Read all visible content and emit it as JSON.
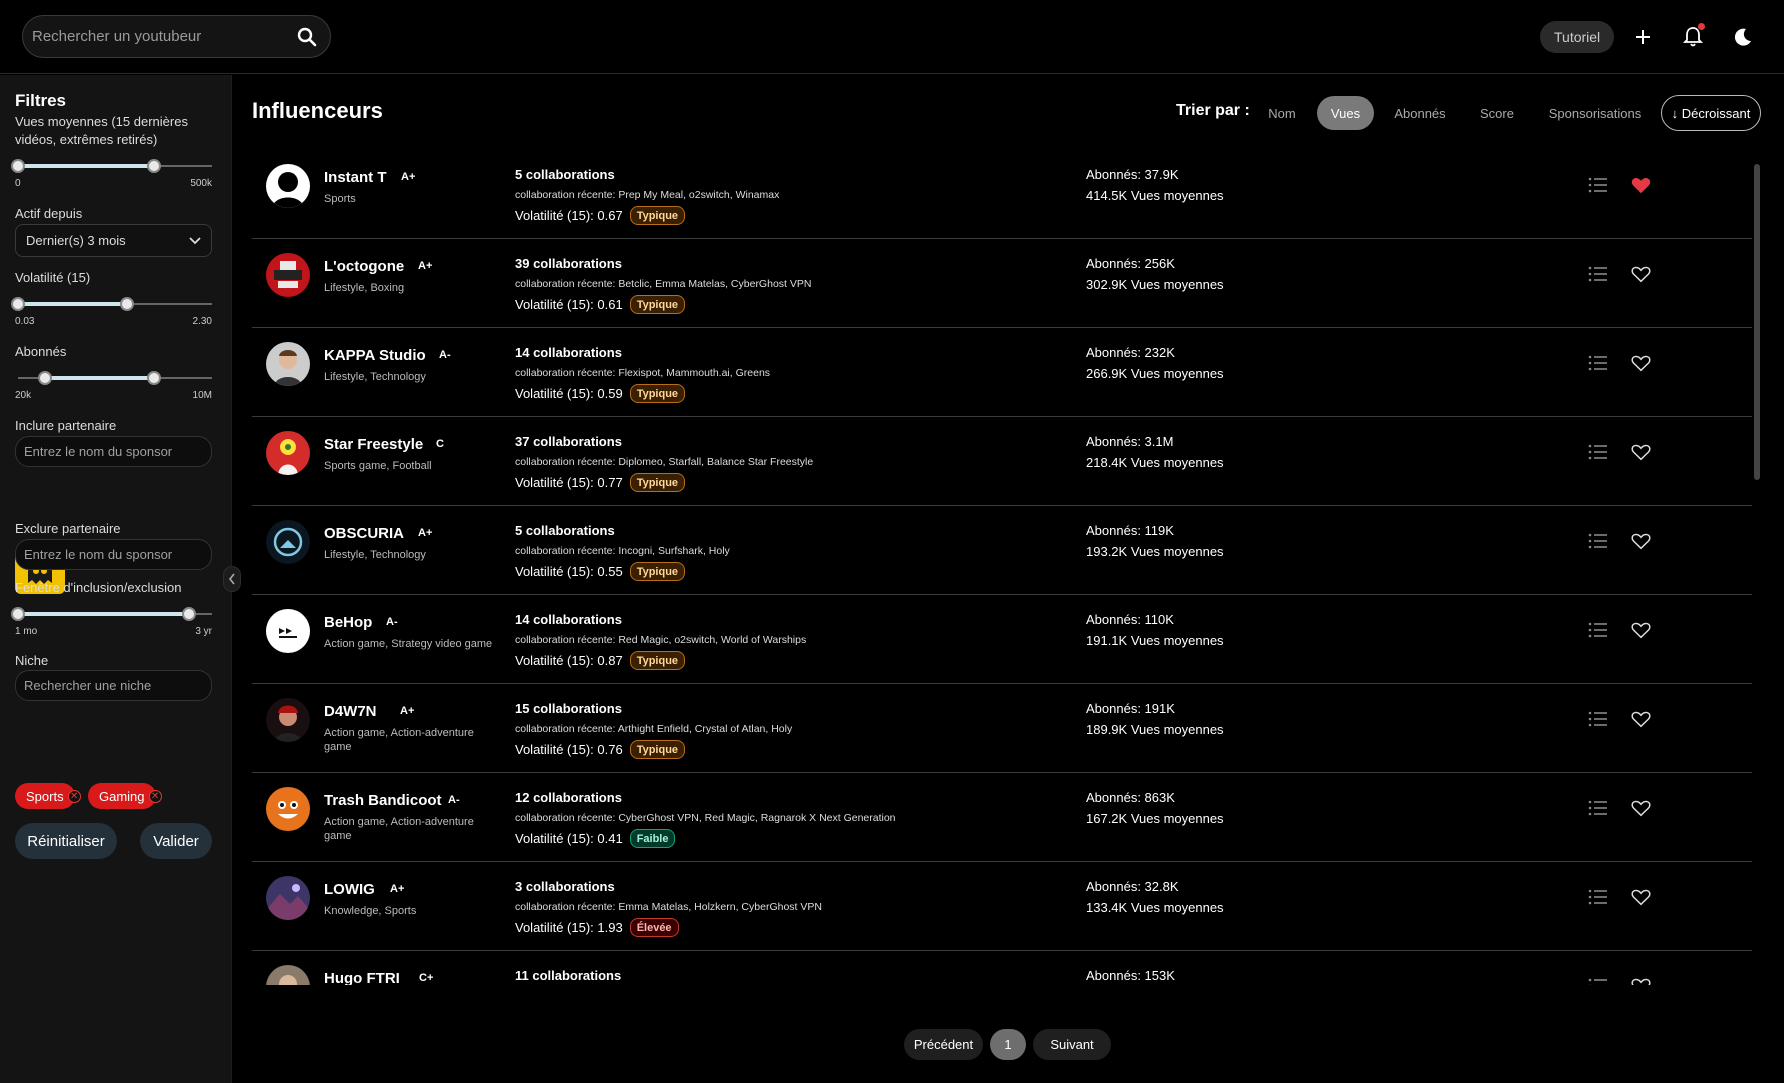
{
  "header": {
    "search_placeholder": "Rechercher un youtubeur",
    "tutorial_label": "Tutoriel",
    "icons": [
      "search-icon",
      "plus-icon",
      "bell-icon",
      "moon-icon"
    ]
  },
  "filters": {
    "title": "Filtres",
    "views_label": "Vues moyennes (15 dernières vidéos, extrêmes retirés)",
    "views_min": "0",
    "views_max": "500k",
    "views_range": [
      0,
      0.7
    ],
    "active_label": "Actif depuis",
    "active_value": "Dernier(s) 3 mois",
    "volatility_label": "Volatilité (15)",
    "volatility_min": "0.03",
    "volatility_max": "2.30",
    "volatility_range": [
      0,
      0.56
    ],
    "subs_label": "Abonnés",
    "subs_min": "20k",
    "subs_max": "10M",
    "subs_range": [
      0.14,
      0.7
    ],
    "include_label": "Inclure partenaire",
    "include_placeholder": "Entrez le nom du sponsor",
    "exclude_label": "Exclure partenaire",
    "exclude_placeholder": "Entrez le nom du sponsor",
    "window_label": "Fenêtre d'inclusion/exclusion",
    "window_min": "1 mo",
    "window_max": "3 yr",
    "window_range": [
      0,
      0.88
    ],
    "niche_label": "Niche",
    "niche_placeholder": "Rechercher une niche",
    "niches": [
      "Sports",
      "Gaming"
    ],
    "reset_label": "Réinitialiser",
    "submit_label": "Valider"
  },
  "main": {
    "title": "Influenceurs",
    "sort_label": "Trier par :",
    "sort_options": [
      "Nom",
      "Vues",
      "Abonnés",
      "Score",
      "Sponsorisations"
    ],
    "sort_active": "Vues",
    "sort_direction": "↓ Décroissant"
  },
  "influencers": [
    {
      "name": "Instant T",
      "grade": "A+",
      "niches": "Sports",
      "collabs": "5 collaborations",
      "recent": "collaboration récente: Prep My Meal, o2switch, Winamax",
      "volatility": "Volatilité (15): 0.67",
      "badge": "Typique",
      "badge_type": "typ",
      "subs": "Abonnés: 37.9K",
      "views": "414.5K Vues moyennes",
      "favorite": true
    },
    {
      "name": "L'octogone",
      "grade": "A+",
      "niches": "Lifestyle, Boxing",
      "collabs": "39 collaborations",
      "recent": "collaboration récente: Betclic, Emma Matelas, CyberGhost VPN",
      "volatility": "Volatilité (15): 0.61",
      "badge": "Typique",
      "badge_type": "typ",
      "subs": "Abonnés: 256K",
      "views": "302.9K Vues moyennes",
      "favorite": false
    },
    {
      "name": "KAPPA Studio",
      "grade": "A-",
      "niches": "Lifestyle, Technology",
      "collabs": "14 collaborations",
      "recent": "collaboration récente: Flexispot, Mammouth.ai, Greens",
      "volatility": "Volatilité (15): 0.59",
      "badge": "Typique",
      "badge_type": "typ",
      "subs": "Abonnés: 232K",
      "views": "266.9K Vues moyennes",
      "favorite": false
    },
    {
      "name": "Star Freestyle",
      "grade": "C",
      "niches": "Sports game, Football",
      "collabs": "37 collaborations",
      "recent": "collaboration récente: Diplomeo, Starfall, Balance Star Freestyle",
      "volatility": "Volatilité (15): 0.77",
      "badge": "Typique",
      "badge_type": "typ",
      "subs": "Abonnés: 3.1M",
      "views": "218.4K Vues moyennes",
      "favorite": false
    },
    {
      "name": "OBSCURIA",
      "grade": "A+",
      "niches": "Lifestyle, Technology",
      "collabs": "5 collaborations",
      "recent": "collaboration récente: Incogni, Surfshark, Holy",
      "volatility": "Volatilité (15): 0.55",
      "badge": "Typique",
      "badge_type": "typ",
      "subs": "Abonnés: 119K",
      "views": "193.2K Vues moyennes",
      "favorite": false
    },
    {
      "name": "BeHop",
      "grade": "A-",
      "niches": "Action game, Strategy video game",
      "collabs": "14 collaborations",
      "recent": "collaboration récente: Red Magic, o2switch, World of Warships",
      "volatility": "Volatilité (15): 0.87",
      "badge": "Typique",
      "badge_type": "typ",
      "subs": "Abonnés: 110K",
      "views": "191.1K Vues moyennes",
      "favorite": false
    },
    {
      "name": "D4W7N",
      "grade": "A+",
      "niches": "Action game, Action-adventure game",
      "collabs": "15 collaborations",
      "recent": "collaboration récente: Arthight Enfield, Crystal of Atlan, Holy",
      "volatility": "Volatilité (15): 0.76",
      "badge": "Typique",
      "badge_type": "typ",
      "subs": "Abonnés: 191K",
      "views": "189.9K Vues moyennes",
      "favorite": false
    },
    {
      "name": "Trash Bandicoot",
      "grade": "A-",
      "niches": "Action game, Action-adventure game",
      "collabs": "12 collaborations",
      "recent": "collaboration récente: CyberGhost VPN, Red Magic, Ragnarok X Next Generation",
      "volatility": "Volatilité (15): 0.41",
      "badge": "Faible",
      "badge_type": "fai",
      "subs": "Abonnés: 863K",
      "views": "167.2K Vues moyennes",
      "favorite": false
    },
    {
      "name": "LOWIG",
      "grade": "A+",
      "niches": "Knowledge, Sports",
      "collabs": "3 collaborations",
      "recent": "collaboration récente: Emma Matelas, Holzkern, CyberGhost VPN",
      "volatility": "Volatilité (15): 1.93",
      "badge": "Élevée",
      "badge_type": "ele",
      "subs": "Abonnés: 32.8K",
      "views": "133.4K Vues moyennes",
      "favorite": false
    },
    {
      "name": "Hugo FTRI",
      "grade": "C+",
      "niches": "",
      "collabs": "11 collaborations",
      "recent": "",
      "volatility": "",
      "badge": "",
      "badge_type": "",
      "subs": "Abonnés: 153K",
      "views": "",
      "favorite": false
    }
  ],
  "pagination": {
    "prev_label": "Précédent",
    "page": "1",
    "next_label": "Suivant"
  },
  "colors": {
    "accent_red": "#d91a1a",
    "active_sort": "#7a7a7a",
    "sponsor_logo": "#f2c200"
  }
}
